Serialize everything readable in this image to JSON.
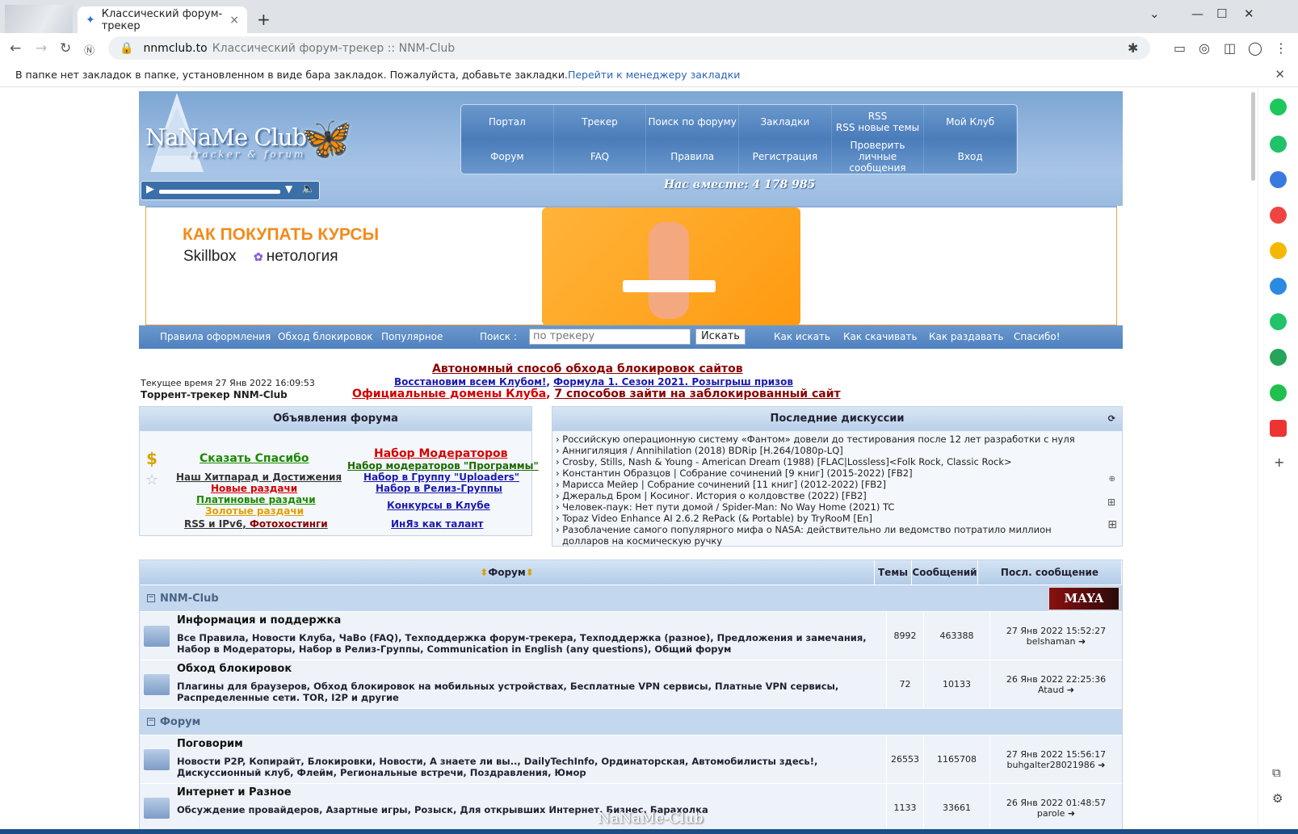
{
  "browser": {
    "tab_title": "Классический форум-трекер",
    "domain": "nnmclub.to",
    "page_title": "Классический форум-трекер :: NNM-Club",
    "bookmark_message": "В папке нет закладок в папке, установленном в виде бара закладок. Пожалуйста, добавьте закладки.",
    "bookmark_link": "Перейти к менеджеру закладки"
  },
  "header": {
    "logo": "NaNaMe Club",
    "logo_sub": "tracker & forum",
    "together": "Нас вместе: 4 178 985",
    "nav_top": [
      "Портал",
      "Трекер",
      "Поиск по форуму",
      "Закладки",
      "RSS\nRSS новые темы",
      "Мой Клуб"
    ],
    "nav_bottom": [
      "Форум",
      "FAQ",
      "Правила",
      "Регистрация",
      "Проверить личные сообщения",
      "Вход"
    ]
  },
  "banner": {
    "headline": "КАК ПОКУПАТЬ КУРСЫ",
    "brand1": "Skillbox",
    "brand2": "нетология"
  },
  "subnav": {
    "links_left": [
      "Правила оформления",
      "Обход блокировок",
      "Популярное"
    ],
    "search_label": "Поиск :",
    "search_placeholder": "по трекеру",
    "search_button": "Искать",
    "links_right": [
      "Как искать",
      "Как скачивать",
      "Как раздавать",
      "Спасибо!"
    ]
  },
  "announce": {
    "line1": "Автономный способ обхода блокировок сайтов",
    "line2a": "Восстановим всем Клубом!",
    "line2b": "Формула 1. Сезон 2021. Розыгрыш призов",
    "line3a": "Официальные домены Клуба",
    "line3b": "7 способов зайти на заблокированный сайт",
    "time": "Текущее время 27 Янв 2022 16:09:53",
    "tracker": "Торрент-трекер NNM-Club"
  },
  "panel_ann": {
    "title": "Объявления форума",
    "spasibo": "Сказать Спасибо",
    "hitparad": "Наш Хитпарад и Достижения",
    "new": "Новые раздачи",
    "platinum": "Платиновые раздачи",
    "gold": "Золотые раздачи",
    "rss": "RSS и IPv6",
    "photo": "Фотохостинги",
    "mods": "Набор Модераторов",
    "mods_prog": "Набор модераторов \"Программы\"",
    "uploaders": "Набор в Группу \"Uploaders\"",
    "release": "Набор в Релиз-Группы",
    "contests": "Конкурсы в Клубе",
    "talent": "ИнЯз как талант"
  },
  "panel_disc": {
    "title": "Последние дискуссии",
    "items": [
      "Российскую операционную систему «Фантом» довели до тестирования после 12 лет разработки с нуля",
      "Аннигиляция / Annihilation (2018) BDRip [H.264/1080p-LQ]",
      "Crosby, Stills, Nash & Young - American Dream (1988) [FLAC|Lossless]<Folk Rock, Classic Rock>",
      "Константин Образцов | Собрание сочинений [9 книг] (2015-2022) [FB2]",
      "Марисса Мейер | Собрание сочинений [11 книг] (2012-2022) [FB2]",
      "Джеральд Бром | Косиног. История о колдовстве (2022) [FB2]",
      "Человек-паук: Нет пути домой / Spider-Man: No Way Home (2021) TC",
      "Topaz Video Enhance AI 2.6.2 RePack (& Portable) by TryRooM [En]",
      "Разоблачение самого популярного мифа о NASA: действительно ли ведомство потратило миллион долларов на космическую ручку"
    ]
  },
  "forum": {
    "col_forum": "Форум",
    "col_topics": "Темы",
    "col_posts": "Сообщений",
    "col_last": "Посл. сообщение",
    "cat1": "NNM-Club",
    "cat2": "Форум",
    "maya": "MAYA",
    "rows": [
      {
        "title": "Информация и поддержка",
        "subs": "Все Правила, Новости Клуба, ЧаВо (FAQ), Техподдержка форум-трекера, Техподдержка (разное), Предложения и замечания, Набор в Модераторы, Набор в Релиз-Группы, Communication in English (any questions), Общий форум",
        "topics": "8992",
        "posts": "463388",
        "date": "27 Янв 2022 15:52:27",
        "user": "belshaman"
      },
      {
        "title": "Обход блокировок",
        "subs": "Плагины для браузеров, Обход блокировок на мобильных устройствах, Бесплатные VPN сервисы, Платные VPN сервисы, Распределенные сети. TOR, I2P и другие",
        "topics": "72",
        "posts": "10133",
        "date": "26 Янв 2022 22:25:36",
        "user": "Ataud"
      },
      {
        "title": "Поговорим",
        "subs": "Новости P2P, Копирайт, Блокировки, Новости, А знаете ли вы.., DailyTechInfo, Ординаторская, Автомобилисты здесь!, Дискуссионный клуб, Флейм, Региональные встречи, Поздравления, Юмор",
        "topics": "26553",
        "posts": "1165708",
        "date": "27 Янв 2022 15:56:17",
        "user": "buhgalter28021986"
      },
      {
        "title": "Интернет и Разное",
        "subs": "Обсуждение провайдеров, Азартные игры, Розыск, Для открывших Интернет, Бизнес, Барахолка",
        "topics": "1133",
        "posts": "33661",
        "date": "26 Янв 2022 01:48:57",
        "user": "parole"
      }
    ]
  },
  "watermark": "NaNaMe-Club"
}
